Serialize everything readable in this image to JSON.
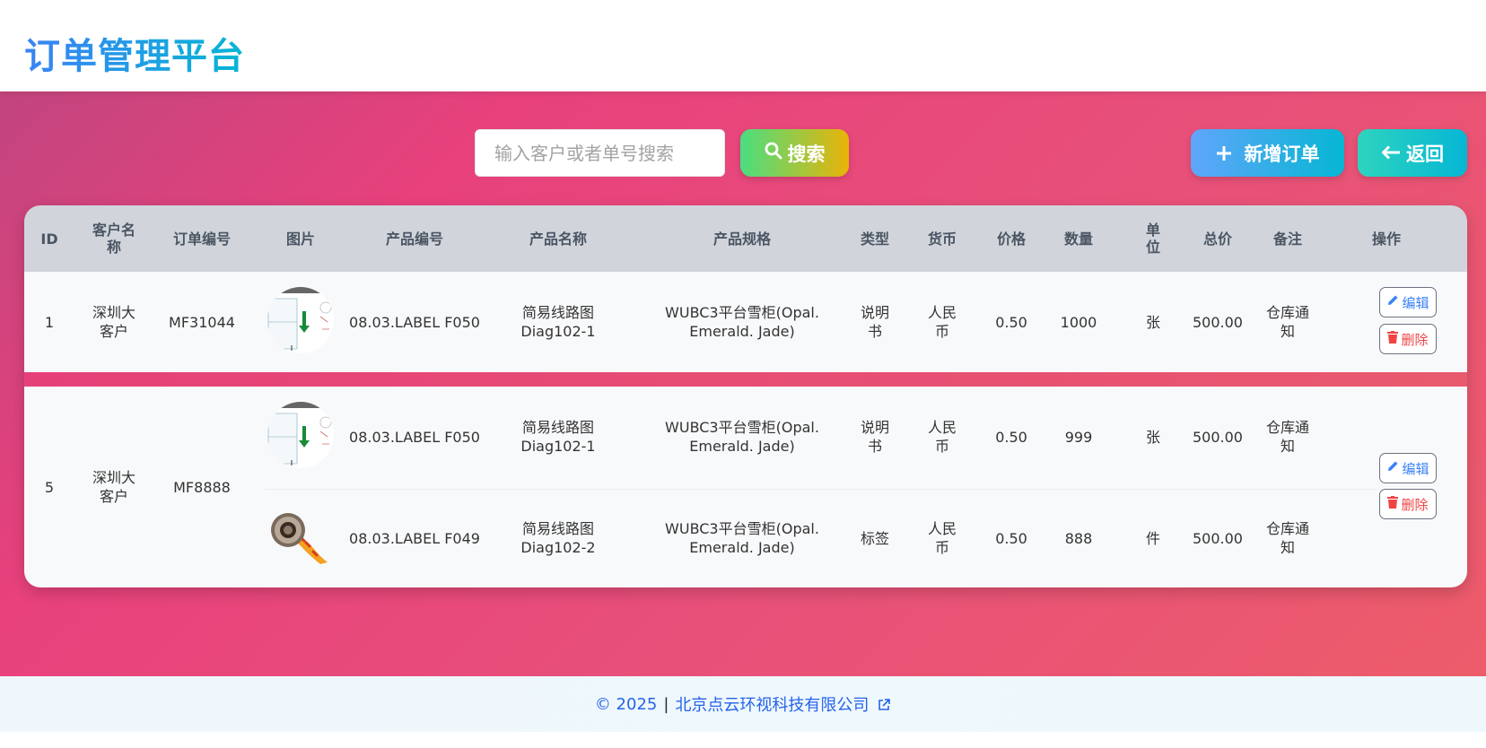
{
  "header": {
    "title": "订单管理平台"
  },
  "toolbar": {
    "search_placeholder": "输入客户或者单号搜索",
    "search_label": "搜索",
    "add_label": "新增订单",
    "back_label": "返回"
  },
  "table": {
    "columns": [
      "ID",
      "客户名称",
      "订单编号",
      "图片",
      "产品编号",
      "产品名称",
      "产品规格",
      "类型",
      "货币",
      "价格",
      "数量",
      "单位",
      "总价",
      "备注",
      "操作"
    ],
    "orders": [
      {
        "id": "1",
        "customer": "深圳大客户",
        "order_no": "MF31044",
        "items": [
          {
            "image": "diagram-thumbnail",
            "product_no": "08.03.LABEL F050",
            "product_name": "简易线路图 Diag102-1",
            "spec": "WUBC3平台雪柜(Opal. Emerald. Jade)",
            "type": "说明书",
            "currency": "人民币",
            "price": "0.50",
            "qty": "1000",
            "unit": "张",
            "total": "500.00",
            "remark": "仓库通知"
          }
        ]
      },
      {
        "id": "5",
        "customer": "深圳大客户",
        "order_no": "MF8888",
        "items": [
          {
            "image": "diagram-thumbnail",
            "product_no": "08.03.LABEL F050",
            "product_name": "简易线路图 Diag102-1",
            "spec": "WUBC3平台雪柜(Opal. Emerald. Jade)",
            "type": "说明书",
            "currency": "人民币",
            "price": "0.50",
            "qty": "999",
            "unit": "张",
            "total": "500.00",
            "remark": "仓库通知"
          },
          {
            "image": "label-roll-thumbnail",
            "product_no": "08.03.LABEL F049",
            "product_name": "简易线路图 Diag102-2",
            "spec": "WUBC3平台雪柜(Opal. Emerald. Jade)",
            "type": "标签",
            "currency": "人民币",
            "price": "0.50",
            "qty": "888",
            "unit": "件",
            "total": "500.00",
            "remark": "仓库通知"
          }
        ]
      }
    ],
    "actions": {
      "edit_label": "编辑",
      "delete_label": "删除"
    }
  },
  "footer": {
    "copyright": "© 2025",
    "separator": "|",
    "company": "北京点云环视科技有限公司"
  },
  "colors": {
    "brand_gradient_start": "#3b82f6",
    "brand_gradient_end": "#06b6d4",
    "background_pink": "#e8417c",
    "edit_blue": "#3b82f6",
    "delete_red": "#ef4444"
  },
  "icons": [
    "search-icon",
    "plus-icon",
    "arrow-left-icon",
    "pencil-icon",
    "trash-icon",
    "external-link-icon"
  ]
}
